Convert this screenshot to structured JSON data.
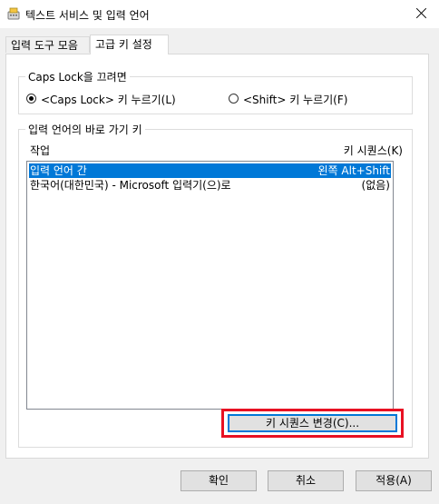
{
  "window": {
    "title": "텍스트 서비스 및 입력 언어",
    "icon": "keyboard-settings-icon"
  },
  "tabs": [
    {
      "label": "입력 도구 모음",
      "selected": false
    },
    {
      "label": "고급 키 설정",
      "selected": true
    }
  ],
  "caps_lock_group": {
    "title": "Caps Lock을 끄려면",
    "options": [
      {
        "label": "<Caps Lock> 키 누르기(L)",
        "checked": true
      },
      {
        "label": "<Shift> 키 누르기(F)",
        "checked": false
      }
    ]
  },
  "hotkeys_group": {
    "title": "입력 언어의 바로 가기 키",
    "columns": {
      "action": "작업",
      "key_sequence": "키 시퀀스(K)"
    },
    "rows": [
      {
        "action": "입력 언어 간",
        "key_sequence": "왼쪽 Alt+Shift",
        "selected": true
      },
      {
        "action": "한국어(대한민국) - Microsoft 입력기(으)로",
        "key_sequence": "(없음)",
        "selected": false
      }
    ],
    "change_button": "키 시퀀스 변경(C)..."
  },
  "buttons": {
    "ok": "확인",
    "cancel": "취소",
    "apply": "적용(A)"
  },
  "colors": {
    "selection": "#0078d7",
    "highlight_box": "#e81123"
  }
}
